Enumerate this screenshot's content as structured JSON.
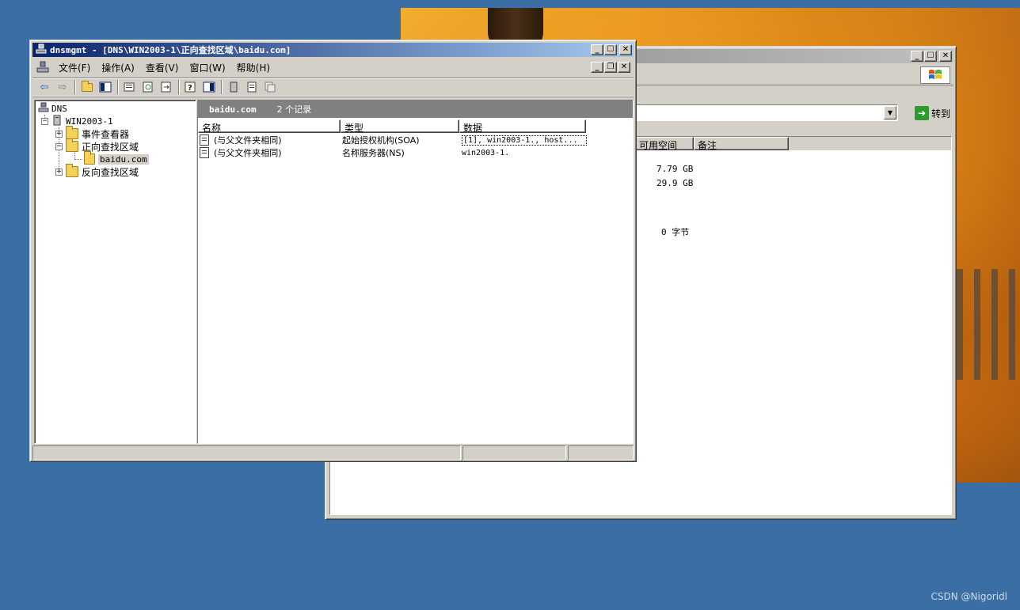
{
  "colors": {
    "desktop": "#3a6ea5",
    "titlebar_active": "#0a246a",
    "titlebar_inactive": "#808080",
    "face": "#d4d0c8"
  },
  "bg_window": {
    "controls": {
      "minimize": "_",
      "maximize": "☐",
      "close": "✕"
    },
    "address": {
      "go_label": "转到"
    },
    "columns": [
      "可用空间",
      "备注"
    ],
    "free_space_values": [
      "7.79 GB",
      "29.9 GB",
      "0 字节"
    ]
  },
  "main_window": {
    "title": "dnsmgmt - [DNS\\WIN2003-1\\正向查找区域\\baidu.com]",
    "controls": {
      "minimize": "_",
      "maximize": "☐",
      "close": "✕"
    },
    "child_controls": {
      "minimize": "_",
      "restore": "❐",
      "close": "✕"
    },
    "menu": [
      {
        "label": "文件(F)"
      },
      {
        "label": "操作(A)"
      },
      {
        "label": "查看(V)"
      },
      {
        "label": "窗口(W)"
      },
      {
        "label": "帮助(H)"
      }
    ],
    "toolbar_icons": [
      "back-icon",
      "forward-icon",
      "up-folder-icon",
      "show-tree-icon",
      "properties-icon",
      "refresh-icon",
      "export-icon",
      "help-icon",
      "action-pane-icon",
      "server-icon",
      "record-icon",
      "copy-icon"
    ],
    "tree": {
      "root": "DNS",
      "server": "WIN2003-1",
      "event_viewer": "事件查看器",
      "forward_zones": "正向查找区域",
      "zone": "baidu.com",
      "reverse_zones": "反向查找区域"
    },
    "detail": {
      "zone_name": "baidu.com",
      "record_count": "2 个记录",
      "columns": [
        "名称",
        "类型",
        "数据"
      ],
      "rows": [
        {
          "name": "(与父文件夹相同)",
          "type": "起始授权机构(SOA)",
          "data": "[1], win2003-1., host..."
        },
        {
          "name": "(与父文件夹相同)",
          "type": "名称服务器(NS)",
          "data": "win2003-1."
        }
      ]
    }
  },
  "watermark": "CSDN @Nigoridl"
}
